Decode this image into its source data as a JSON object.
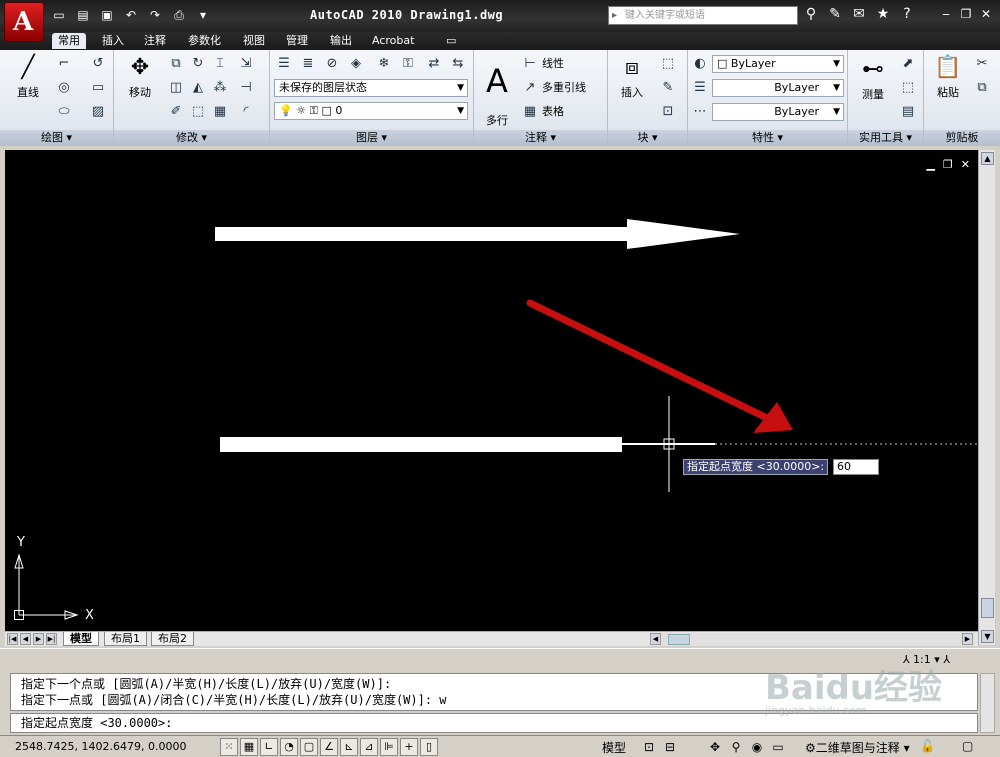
{
  "title": "AutoCAD 2010   Drawing1.dwg",
  "search_placeholder": "键入关键字或短语",
  "tabs": [
    "常用",
    "插入",
    "注释",
    "参数化",
    "视图",
    "管理",
    "输出",
    "Acrobat"
  ],
  "panels": {
    "draw": {
      "title": "绘图",
      "line_label": "直线"
    },
    "modify": {
      "title": "修改",
      "move_label": "移动"
    },
    "layers": {
      "title": "图层",
      "state": "未保存的图层状态",
      "layer_name": "0"
    },
    "annotation": {
      "title": "注释",
      "mtext_label": "多行\n文字",
      "linear": "线性",
      "mleader": "多重引线",
      "table": "表格"
    },
    "block": {
      "title": "块",
      "insert_label": "插入"
    },
    "properties": {
      "title": "特性",
      "color": "ByLayer",
      "linetype": "ByLayer",
      "lineweight": "ByLayer"
    },
    "utilities": {
      "title": "实用工具",
      "measure_label": "测量"
    },
    "clipboard": {
      "title": "剪贴板",
      "paste_label": "粘贴"
    }
  },
  "drawing": {
    "dyn_prompt": "指定起点宽度 <30.0000>:",
    "dyn_value": "60",
    "ucs_x": "X",
    "ucs_y": "Y"
  },
  "layout_tabs": [
    "模型",
    "布局1",
    "布局2"
  ],
  "anno_scale": "1:1",
  "command_history": [
    "指定下一个点或 [圆弧(A)/半宽(H)/长度(L)/放弃(U)/宽度(W)]:",
    "指定下一点或 [圆弧(A)/闭合(C)/半宽(H)/长度(L)/放弃(U)/宽度(W)]: w"
  ],
  "command_prompt": "指定起点宽度 <30.0000>:",
  "status": {
    "coords": "2548.7425, 1402.6479, 0.0000",
    "model_label": "模型",
    "workspace": "二维草图与注释"
  },
  "watermark": {
    "brand": "Baidu经验",
    "url": "jingyan.baidu.com"
  },
  "colors": {
    "arrow_red": "#c80f0f",
    "canvas": "#000000"
  }
}
